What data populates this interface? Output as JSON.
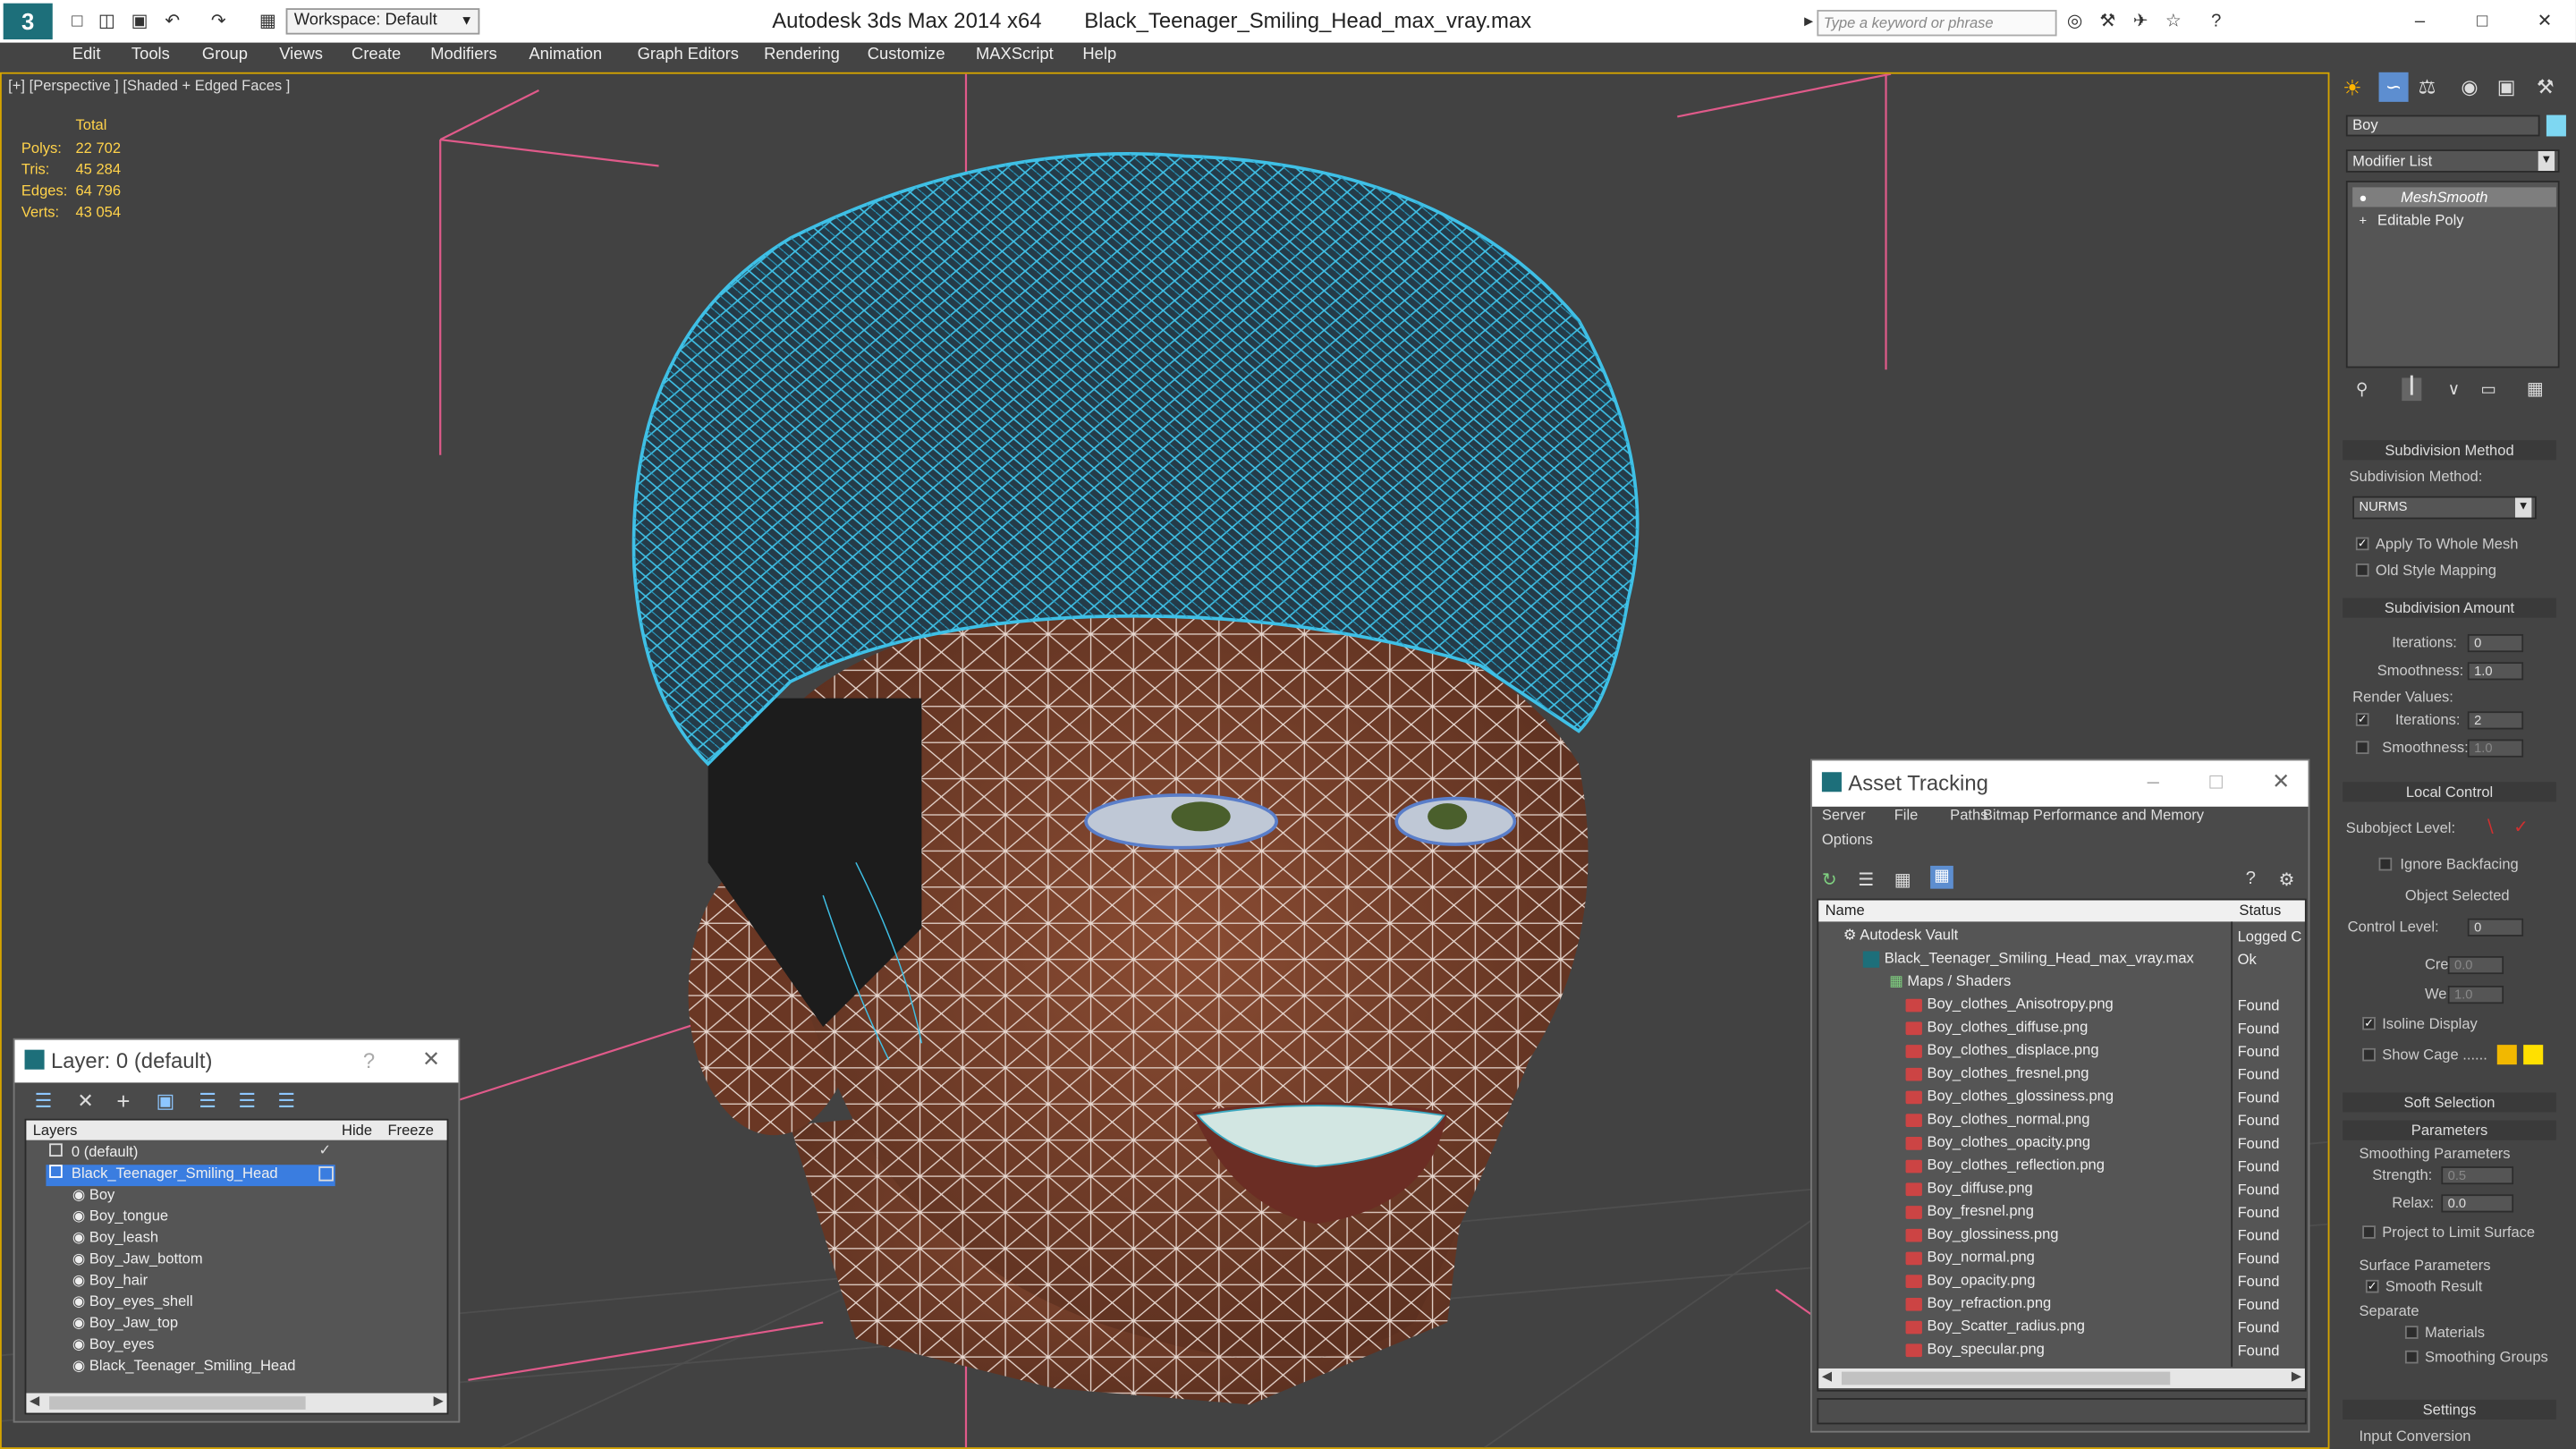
{
  "titlebar": {
    "app_title": "Autodesk 3ds Max  2014 x64",
    "file_name": "Black_Teenager_Smiling_Head_max_vray.max",
    "workspace": "Workspace: Default",
    "search_placeholder": "Type a keyword or phrase"
  },
  "menu": [
    "Edit",
    "Tools",
    "Group",
    "Views",
    "Create",
    "Modifiers",
    "Animation",
    "Graph Editors",
    "Rendering",
    "Customize",
    "MAXScript",
    "Help"
  ],
  "viewport": {
    "label": "[+] [Perspective ] [Shaded + Edged Faces ]",
    "stats": {
      "header": "Total",
      "rows": [
        {
          "label": "Polys:",
          "value": "22 702"
        },
        {
          "label": "Tris:",
          "value": "45 284"
        },
        {
          "label": "Edges:",
          "value": "64 796"
        },
        {
          "label": "Verts:",
          "value": "43 054"
        }
      ]
    }
  },
  "command_panel": {
    "object_name": "Boy",
    "modifier_list": "Modifier List",
    "stack": [
      "MeshSmooth",
      "Editable Poly"
    ],
    "subdivision_method": {
      "title": "Subdivision Method",
      "label": "Subdivision Method:",
      "value": "NURMS",
      "apply_whole_mesh": "Apply To Whole Mesh",
      "old_style_mapping": "Old Style Mapping"
    },
    "subdivision_amount": {
      "title": "Subdivision Amount",
      "iterations_label": "Iterations:",
      "iterations_value": "0",
      "smoothness_label": "Smoothness:",
      "smoothness_value": "1.0",
      "render_values": "Render Values:",
      "r_iterations_label": "Iterations:",
      "r_iterations_value": "2",
      "r_smoothness_label": "Smoothness:",
      "r_smoothness_value": "1.0"
    },
    "local_control": {
      "title": "Local Control",
      "subobject_label": "Subobject Level:",
      "ignore_backfacing": "Ignore Backfacing",
      "object_selected": "Object Selected",
      "control_level_label": "Control Level:",
      "control_level_value": "0",
      "crease_label": "Crease:",
      "crease_value": "0.0",
      "weight_label": "Weight:",
      "weight_value": "1.0",
      "isoline": "Isoline Display",
      "show_cage": "Show Cage ......"
    },
    "soft_selection": "Soft Selection",
    "parameters": {
      "title": "Parameters",
      "smoothing": "Smoothing Parameters",
      "strength_label": "Strength:",
      "strength_value": "0.5",
      "relax_label": "Relax:",
      "relax_value": "0.0",
      "project": "Project to Limit Surface",
      "surface": "Surface Parameters",
      "smooth_result": "Smooth Result",
      "separate": "Separate",
      "materials": "Materials",
      "smoothing_groups": "Smoothing Groups"
    },
    "settings": "Settings",
    "input_conversion": "Input Conversion"
  },
  "layer_window": {
    "title": "Layer: 0 (default)",
    "col_layers": "Layers",
    "col_hide": "Hide",
    "col_freeze": "Freeze",
    "layers": [
      "0 (default)",
      "Black_Teenager_Smiling_Head"
    ],
    "objects": [
      "Boy",
      "Boy_tongue",
      "Boy_leash",
      "Boy_Jaw_bottom",
      "Boy_hair",
      "Boy_eyes_shell",
      "Boy_Jaw_top",
      "Boy_eyes",
      "Black_Teenager_Smiling_Head"
    ]
  },
  "asset_window": {
    "title": "Asset Tracking",
    "menu": [
      "Server",
      "File",
      "Paths",
      "Bitmap Performance and Memory",
      "Options"
    ],
    "col_name": "Name",
    "col_status": "Status",
    "vault": {
      "name": "Autodesk Vault",
      "status": "Logged C"
    },
    "file": {
      "name": "Black_Teenager_Smiling_Head_max_vray.max",
      "status": "Ok"
    },
    "maps_label": "Maps / Shaders",
    "maps": [
      {
        "name": "Boy_clothes_Anisotropy.png",
        "status": "Found"
      },
      {
        "name": "Boy_clothes_diffuse.png",
        "status": "Found"
      },
      {
        "name": "Boy_clothes_displace.png",
        "status": "Found"
      },
      {
        "name": "Boy_clothes_fresnel.png",
        "status": "Found"
      },
      {
        "name": "Boy_clothes_glossiness.png",
        "status": "Found"
      },
      {
        "name": "Boy_clothes_normal.png",
        "status": "Found"
      },
      {
        "name": "Boy_clothes_opacity.png",
        "status": "Found"
      },
      {
        "name": "Boy_clothes_reflection.png",
        "status": "Found"
      },
      {
        "name": "Boy_diffuse.png",
        "status": "Found"
      },
      {
        "name": "Boy_fresnel.png",
        "status": "Found"
      },
      {
        "name": "Boy_glossiness.png",
        "status": "Found"
      },
      {
        "name": "Boy_normal.png",
        "status": "Found"
      },
      {
        "name": "Boy_opacity.png",
        "status": "Found"
      },
      {
        "name": "Boy_refraction.png",
        "status": "Found"
      },
      {
        "name": "Boy_Scatter_radius.png",
        "status": "Found"
      },
      {
        "name": "Boy_specular.png",
        "status": "Found"
      }
    ]
  }
}
